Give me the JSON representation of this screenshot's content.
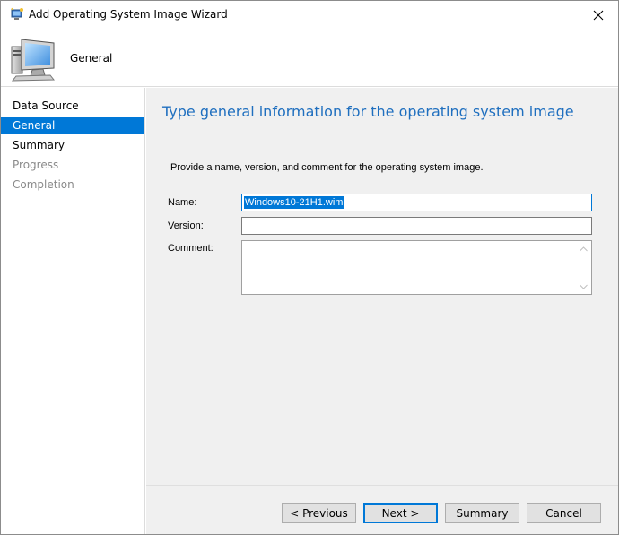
{
  "window": {
    "title": "Add Operating System Image Wizard",
    "close_glyph": "✕"
  },
  "banner": {
    "title": "General",
    "icon": "computer-icon"
  },
  "nav": {
    "items": [
      {
        "label": "Data Source",
        "state": "normal"
      },
      {
        "label": "General",
        "state": "selected"
      },
      {
        "label": "Summary",
        "state": "normal"
      },
      {
        "label": "Progress",
        "state": "disabled"
      },
      {
        "label": "Completion",
        "state": "disabled"
      }
    ]
  },
  "page": {
    "heading": "Type general information for the operating system image",
    "instruction": "Provide a name, version, and comment for the operating system image.",
    "name_label": "Name:",
    "name_value": "Windows10-21H1.wim",
    "version_label": "Version:",
    "version_value": "",
    "comment_label": "Comment:",
    "comment_value": ""
  },
  "buttons": {
    "previous": "< Previous",
    "next": "Next >",
    "summary": "Summary",
    "cancel": "Cancel"
  },
  "colors": {
    "accent": "#0078d7",
    "heading": "#1f6fbf",
    "panel": "#f0f0f0"
  }
}
